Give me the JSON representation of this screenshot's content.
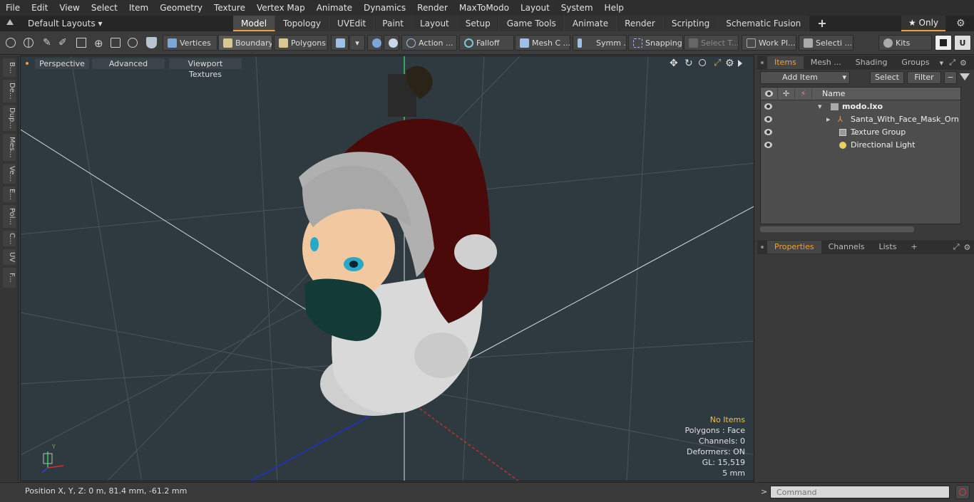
{
  "menu": [
    "File",
    "Edit",
    "View",
    "Select",
    "Item",
    "Geometry",
    "Texture",
    "Vertex Map",
    "Animate",
    "Dynamics",
    "Render",
    "MaxToModo",
    "Layout",
    "System",
    "Help"
  ],
  "layout": {
    "preset": "Default Layouts ▾",
    "tabs": [
      "Model",
      "Topology",
      "UVEdit",
      "Paint",
      "Layout",
      "Setup",
      "Game Tools",
      "Animate",
      "Render",
      "Scripting",
      "Schematic Fusion"
    ],
    "active_tab": "Model",
    "add_tab": "+",
    "only_label": "★  Only"
  },
  "toolbar": {
    "vertices": "Vertices",
    "boundary": "Boundary",
    "polygons": "Polygons",
    "action": "Action",
    "falloff": "Falloff",
    "mesh_c": "Mesh C ...",
    "symm": "Symm ...",
    "snapping": "Snapping",
    "select_t": "Select T...",
    "work_pl": "Work Pl...",
    "selecti": "Selecti ...",
    "kits": "Kits",
    "ellipsis": "..."
  },
  "left_tabs": [
    "B...",
    "De...",
    "Dup...",
    "Mes...",
    "Ve...",
    "E...",
    "Pol...",
    "C...",
    "UV",
    "F..."
  ],
  "viewport": {
    "view_mode": "Perspective",
    "advanced": "Advanced",
    "textures": "Viewport Textures",
    "info": {
      "no_items": "No Items",
      "polygons": "Polygons : Face",
      "channels": "Channels: 0",
      "deformers": "Deformers: ON",
      "gl": "GL: 15,519",
      "scale": "5 mm"
    },
    "axis_y": "Y"
  },
  "status": "Position X, Y, Z:   0 m, 81.4 mm, -61.2 mm",
  "items_panel": {
    "tabs": [
      "Items",
      "Mesh ...",
      "Shading",
      "Groups"
    ],
    "active_tab": "Items",
    "add_item": "Add Item",
    "select": "Select",
    "filter": "Filter",
    "col_name": "Name",
    "tree": [
      {
        "label": "modo.lxo",
        "indent": 0,
        "bold": true
      },
      {
        "label": "Santa_With_Face_Mask_Orn ...",
        "indent": 1
      },
      {
        "label": "Texture Group",
        "indent": 1
      },
      {
        "label": "Directional Light",
        "indent": 1
      }
    ]
  },
  "props_panel": {
    "tabs": [
      "Properties",
      "Channels",
      "Lists"
    ],
    "active_tab": "Properties",
    "add": "+"
  },
  "command": {
    "placeholder": "Command",
    "prompt": ">"
  },
  "colors": {
    "accent": "#e8a040",
    "viewport_bg": "#2f3a40",
    "hat": "#4a0a0a"
  }
}
